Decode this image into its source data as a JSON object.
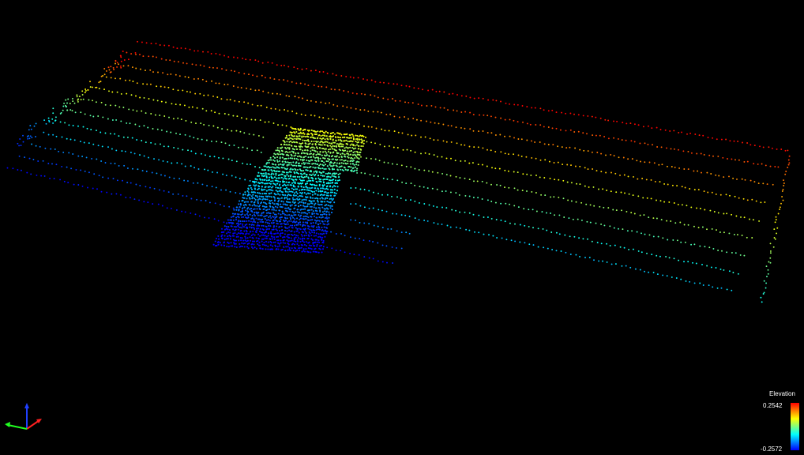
{
  "viewer": {
    "background": "#000000"
  },
  "legend": {
    "title": "Elevation",
    "max_label": "0.2542",
    "min_label": "-0.2572",
    "max_value": 0.2542,
    "min_value": -0.2572,
    "colormap": [
      "#ff0000",
      "#ffff00",
      "#00ffff",
      "#0000ff"
    ]
  },
  "axes_gizmo": {
    "x_color": "#ff2020",
    "y_color": "#20ff20",
    "z_color": "#2040ff"
  }
}
